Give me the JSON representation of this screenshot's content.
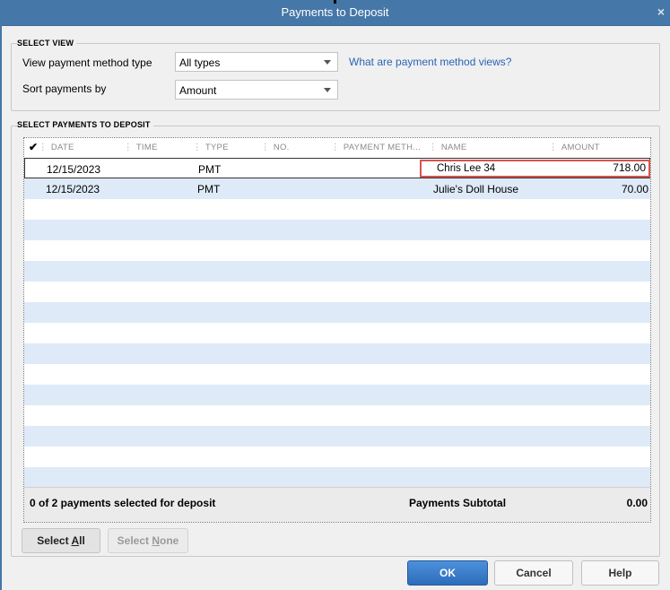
{
  "window": {
    "title": "Payments to Deposit",
    "close_label": "×"
  },
  "select_view": {
    "section_label": "SELECT VIEW",
    "method_label": "View payment method type",
    "method_value": "All types",
    "sort_label": "Sort payments by",
    "sort_value": "Amount",
    "help_link": "What are payment method views?"
  },
  "payments": {
    "section_label": "SELECT PAYMENTS TO DEPOSIT",
    "check_header": "✔",
    "columns": [
      "DATE",
      "TIME",
      "TYPE",
      "NO.",
      "PAYMENT METH...",
      "NAME",
      "AMOUNT"
    ],
    "rows": [
      {
        "date": "12/15/2023",
        "time": "",
        "type": "PMT",
        "no": "",
        "method": "",
        "name": "Chris Lee 34",
        "amount": "718.00"
      },
      {
        "date": "12/15/2023",
        "time": "",
        "type": "PMT",
        "no": "",
        "method": "",
        "name": "Julie's Doll House",
        "amount": "70.00"
      }
    ],
    "summary": "0 of 2 payments selected for deposit",
    "subtotal_label": "Payments Subtotal",
    "subtotal_value": "0.00"
  },
  "buttons": {
    "select_all_pre": "Select ",
    "select_all_key": "A",
    "select_all_post": "ll",
    "select_none_pre": "Select ",
    "select_none_key": "N",
    "select_none_post": "one",
    "ok": "OK",
    "cancel": "Cancel",
    "help": "Help"
  },
  "colors": {
    "titlebar": "#4577a8",
    "row_alt": "#deeaf8",
    "highlight": "#d9534f",
    "ok_button": "#2d6cb8",
    "link": "#2b63b5"
  }
}
